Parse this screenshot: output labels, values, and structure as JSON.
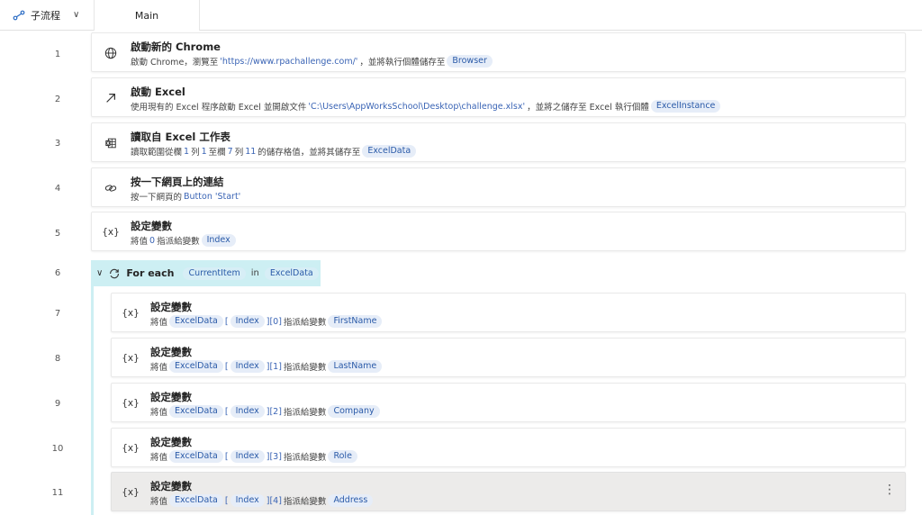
{
  "topbar": {
    "subflow_label": "子流程",
    "tab_main": "Main"
  },
  "rows": [
    {
      "num": "1",
      "icon": "globe-icon",
      "title": "啟動新的 Chrome",
      "desc_pre": "啟動 Chrome，瀏覽至 ",
      "desc_q": "'https://www.rpachallenge.com/'",
      "desc_post": "，並將執行個體儲存至",
      "var": "Browser"
    },
    {
      "num": "2",
      "icon": "arrow-up-right-icon",
      "title": "啟動 Excel",
      "desc_pre": "使用現有的 Excel 程序啟動 Excel 並開啟文件 ",
      "desc_q": "'C:\\Users\\AppWorksSchool\\Desktop\\challenge.xlsx'",
      "desc_post": "，並將之儲存至 Excel 執行個體",
      "var": "ExcelInstance"
    },
    {
      "num": "3",
      "icon": "excel-read-icon",
      "title": "讀取自 Excel 工作表",
      "desc_a": "讀取範圍從欄 ",
      "desc_n1": "1",
      "desc_b": " 列 ",
      "desc_n2": "1",
      "desc_c": " 至欄 ",
      "desc_n3": "7",
      "desc_d": " 列 ",
      "desc_n4": "11",
      "desc_e": " 的儲存格值，並將其儲存至",
      "var": "ExcelData"
    },
    {
      "num": "4",
      "icon": "link-icon",
      "title": "按一下網頁上的連結",
      "desc_pre": "按一下網頁的 ",
      "desc_q": "Button 'Start'"
    },
    {
      "num": "5",
      "icon": "variable-icon",
      "title": "設定變數",
      "desc_pre": "將值 ",
      "desc_q": "0",
      "desc_post": " 指派給變數",
      "var": "Index"
    }
  ],
  "foreach": {
    "num": "6",
    "title": "For each",
    "item_var": "CurrentItem",
    "in_label": "in",
    "list_var": "ExcelData"
  },
  "inner_rows": [
    {
      "num": "7",
      "title": "設定變數",
      "pre": "將值",
      "v1": "ExcelData",
      "lb": "[",
      "v2": "Index",
      "idx": "][0]",
      "mid": "指派給變數",
      "target": "FirstName"
    },
    {
      "num": "8",
      "title": "設定變數",
      "pre": "將值",
      "v1": "ExcelData",
      "lb": "[",
      "v2": "Index",
      "idx": "][1]",
      "mid": "指派給變數",
      "target": "LastName"
    },
    {
      "num": "9",
      "title": "設定變數",
      "pre": "將值",
      "v1": "ExcelData",
      "lb": "[",
      "v2": "Index",
      "idx": "][2]",
      "mid": "指派給變數",
      "target": "Company"
    },
    {
      "num": "10",
      "title": "設定變數",
      "pre": "將值",
      "v1": "ExcelData",
      "lb": "[",
      "v2": "Index",
      "idx": "][3]",
      "mid": "指派給變數",
      "target": "Role"
    },
    {
      "num": "11",
      "title": "設定變數",
      "pre": "將值",
      "v1": "ExcelData",
      "lb": "[",
      "v2": "Index",
      "idx": "][4]",
      "mid": "指派給變數",
      "target": "Address"
    }
  ],
  "variable_icon_text": "{x}",
  "more_icon_text": "⋮"
}
